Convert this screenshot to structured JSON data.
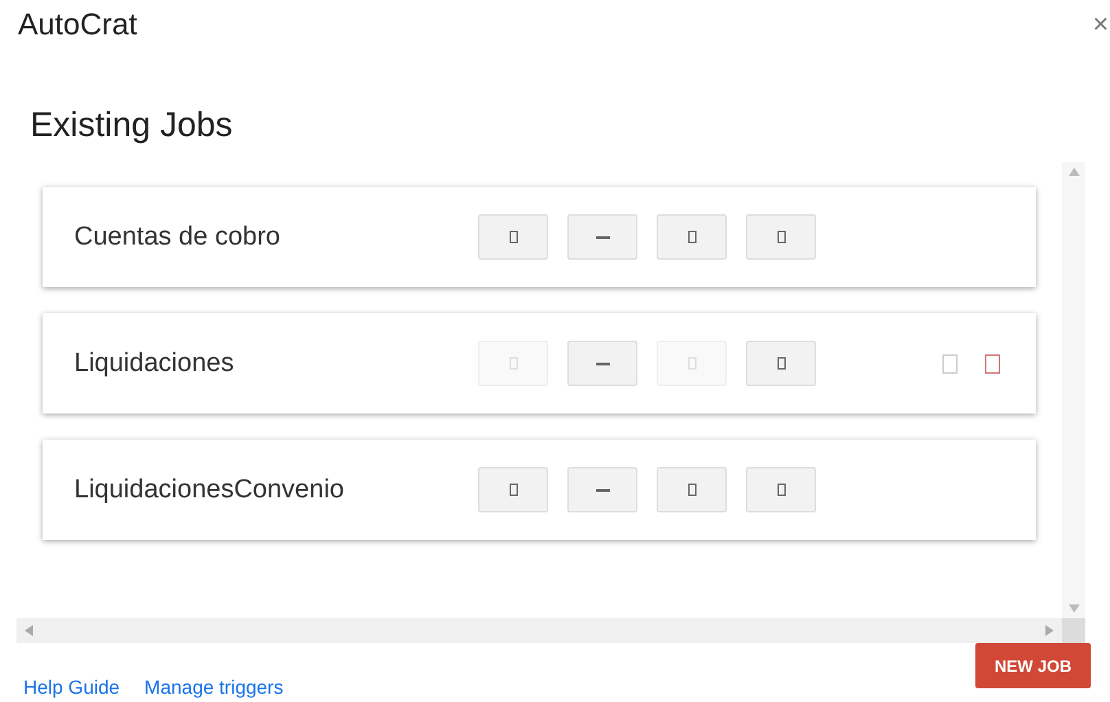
{
  "window": {
    "title": "AutoCrat",
    "close": "×"
  },
  "heading": "Existing Jobs",
  "jobs": [
    {
      "name": "Cuentas de cobro",
      "hovered": false,
      "buttons": [
        {
          "kind": "box",
          "disabled": false
        },
        {
          "kind": "dash",
          "disabled": false
        },
        {
          "kind": "box",
          "disabled": false
        },
        {
          "kind": "box",
          "disabled": false
        }
      ]
    },
    {
      "name": "Liquidaciones",
      "hovered": true,
      "buttons": [
        {
          "kind": "box",
          "disabled": true
        },
        {
          "kind": "dash",
          "disabled": false
        },
        {
          "kind": "box",
          "disabled": true
        },
        {
          "kind": "box",
          "disabled": false
        }
      ]
    },
    {
      "name": "LiquidacionesConvenio",
      "hovered": false,
      "buttons": [
        {
          "kind": "box",
          "disabled": false
        },
        {
          "kind": "dash",
          "disabled": false
        },
        {
          "kind": "box",
          "disabled": false
        },
        {
          "kind": "box",
          "disabled": false
        }
      ]
    }
  ],
  "new_job": "NEW JOB",
  "links": [
    "Help Guide",
    "Manage triggers"
  ]
}
